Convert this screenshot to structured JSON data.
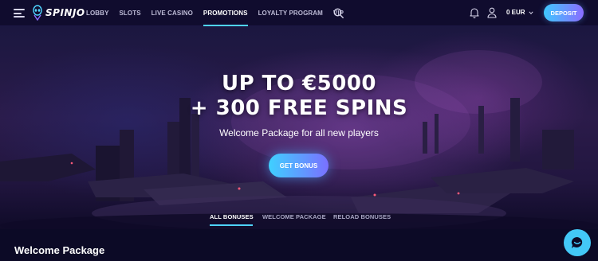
{
  "header": {
    "logo_text": "SPINJO",
    "nav": [
      {
        "label": "LOBBY",
        "active": false
      },
      {
        "label": "SLOTS",
        "active": false
      },
      {
        "label": "LIVE CASINO",
        "active": false
      },
      {
        "label": "PROMOTIONS",
        "active": true
      },
      {
        "label": "LOYALTY PROGRAM",
        "active": false
      },
      {
        "label": "VIP",
        "active": false
      }
    ],
    "balance": "0 EUR",
    "deposit_label": "DEPOSIT",
    "icons": [
      "menu-icon",
      "search-icon",
      "bell-icon",
      "user-icon",
      "chevron-down-icon"
    ]
  },
  "hero": {
    "title_line1": "UP TO €5000",
    "title_line2": "+ 300 FREE SPINS",
    "subtitle": "Welcome Package for all new players",
    "cta_label": "GET BONUS"
  },
  "tabs": [
    {
      "label": "ALL BONUSES",
      "active": true
    },
    {
      "label": "WELCOME PACKAGE",
      "active": false
    },
    {
      "label": "RELOAD BONUSES",
      "active": false
    }
  ],
  "section": {
    "title": "Welcome Package"
  },
  "colors": {
    "accent": "#4fd4ff",
    "gradient_end": "#8a6cff",
    "background": "#0c0a26",
    "chat": "#43c8f7"
  }
}
